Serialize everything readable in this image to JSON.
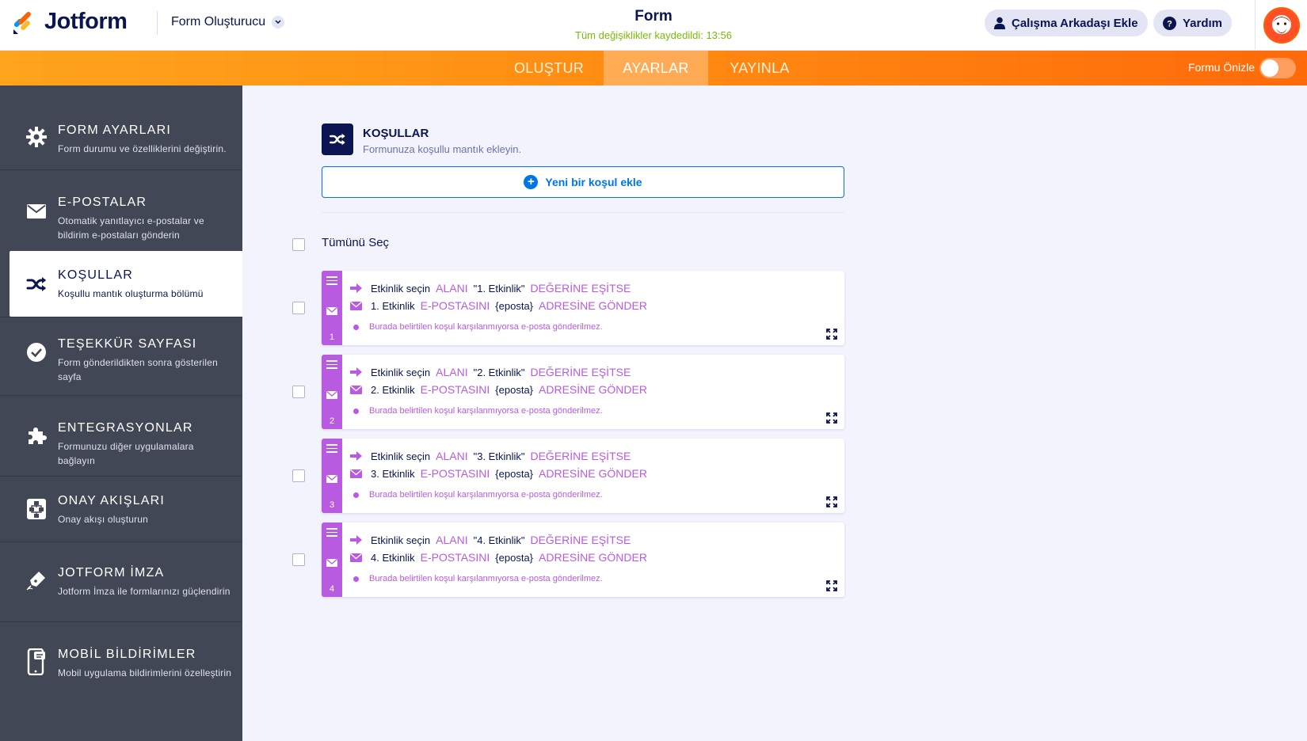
{
  "header": {
    "logo_text": "Jotform",
    "builder_label": "Form Oluşturucu",
    "form_title": "Form",
    "save_status": "Tüm değişiklikler kaydedildi: 13:56",
    "add_collaborator_label": "Çalışma Arkadaşı Ekle",
    "help_label": "Yardım"
  },
  "nav": {
    "tabs": [
      {
        "label": "OLUŞTUR"
      },
      {
        "label": "AYARLAR"
      },
      {
        "label": "YAYINLA"
      }
    ],
    "preview_label": "Formu Önizle"
  },
  "sidebar": {
    "items": [
      {
        "title": "FORM AYARLARI",
        "desc": "Form durumu ve özelliklerini değiştirin.",
        "icon": "gear-icon"
      },
      {
        "title": "E-POSTALAR",
        "desc": "Otomatik yanıtlayıcı e-postalar ve bildirim e-postaları gönderin",
        "icon": "envelope-icon"
      },
      {
        "title": "KOŞULLAR",
        "desc": "Koşullu mantık oluşturma bölümü",
        "icon": "shuffle-icon"
      },
      {
        "title": "TEŞEKKÜR SAYFASI",
        "desc": "Form gönderildikten sonra gösterilen sayfa",
        "icon": "check-circle-icon"
      },
      {
        "title": "ENTEGRASYONLAR",
        "desc": "Formunuzu diğer uygulamalara bağlayın",
        "icon": "puzzle-icon"
      },
      {
        "title": "ONAY AKIŞLARI",
        "desc": "Onay akışı oluşturun",
        "icon": "flow-icon"
      },
      {
        "title": "JOTFORM İMZA",
        "desc": "Jotform İmza ile formlarınızı güçlendirin",
        "icon": "pen-icon"
      },
      {
        "title": "MOBİL BİLDİRİMLER",
        "desc": "Mobil uygulama bildirimlerini özelleştirin",
        "icon": "mobile-icon"
      }
    ]
  },
  "main": {
    "section_title": "KOŞULLAR",
    "section_subtitle": "Formunuza koşullu mantık ekleyin.",
    "add_button_label": "Yeni bir koşul ekle",
    "select_all_label": "Tümünü Seç",
    "rules": [
      {
        "number": "1",
        "if_field": "Etkinlik seçin",
        "kw_field": "ALANI",
        "value": "\"1. Etkinlik\"",
        "kw_equals": "DEĞERİNE EŞİTSE",
        "email_name": "1. Etkinlik",
        "kw_email": "E-POSTASINI",
        "address": "{eposta}",
        "kw_send": "ADRESİNE GÖNDER",
        "note": "Burada belirtilen koşul karşılanmıyorsa e-posta gönderilmez."
      },
      {
        "number": "2",
        "if_field": "Etkinlik seçin",
        "kw_field": "ALANI",
        "value": "\"2. Etkinlik\"",
        "kw_equals": "DEĞERİNE EŞİTSE",
        "email_name": "2. Etkinlik",
        "kw_email": "E-POSTASINI",
        "address": "{eposta}",
        "kw_send": "ADRESİNE GÖNDER",
        "note": "Burada belirtilen koşul karşılanmıyorsa e-posta gönderilmez."
      },
      {
        "number": "3",
        "if_field": "Etkinlik seçin",
        "kw_field": "ALANI",
        "value": "\"3. Etkinlik\"",
        "kw_equals": "DEĞERİNE EŞİTSE",
        "email_name": "3. Etkinlik",
        "kw_email": "E-POSTASINI",
        "address": "{eposta}",
        "kw_send": "ADRESİNE GÖNDER",
        "note": "Burada belirtilen koşul karşılanmıyorsa e-posta gönderilmez."
      },
      {
        "number": "4",
        "if_field": "Etkinlik seçin",
        "kw_field": "ALANI",
        "value": "\"4. Etkinlik\"",
        "kw_equals": "DEĞERİNE EŞİTSE",
        "email_name": "4. Etkinlik",
        "kw_email": "E-POSTASINI",
        "address": "{eposta}",
        "kw_send": "ADRESİNE GÖNDER",
        "note": "Burada belirtilen koşul karşılanmıyorsa e-posta gönderilmez."
      }
    ]
  },
  "colors": {
    "brand_navy": "#0a1551",
    "nav_orange": "#ff8b12",
    "sidebar_bg": "#424755",
    "rule_purple": "#b95be0",
    "primary_blue": "#0075e3",
    "saved_green": "#78bb07"
  }
}
